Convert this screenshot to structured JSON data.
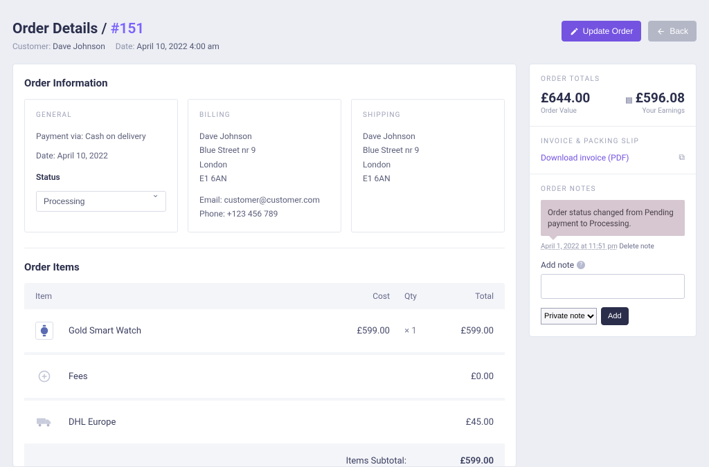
{
  "header": {
    "title_prefix": "Order Details",
    "slash": "/",
    "order_id": "#151",
    "customer_label": "Customer:",
    "customer_name": "Dave Johnson",
    "date_label": "Date:",
    "date_value": "April 10, 2022 4:00 am",
    "update_btn": "Update Order",
    "back_btn": "Back"
  },
  "info": {
    "section_title": "Order Information",
    "general": {
      "head": "GENERAL",
      "payment_line": "Payment via: Cash on delivery",
      "date_line": "Date: April 10, 2022",
      "status_label": "Status",
      "status_value": "Processing"
    },
    "billing": {
      "head": "BILLING",
      "name": "Dave Johnson",
      "street": "Blue Street nr 9",
      "city": "London",
      "postcode": "E1 6AN",
      "email_line": "Email: customer@customer.com",
      "phone_line": "Phone: +123 456 789"
    },
    "shipping": {
      "head": "SHIPPING",
      "name": "Dave Johnson",
      "street": "Blue Street nr 9",
      "city": "London",
      "postcode": "E1 6AN"
    }
  },
  "items_section": {
    "title": "Order Items",
    "col_item": "Item",
    "col_cost": "Cost",
    "col_qty": "Qty",
    "col_total": "Total",
    "rows": [
      {
        "icon": "watch",
        "name": "Gold Smart Watch",
        "cost": "£599.00",
        "qty": "× 1",
        "total": "£599.00"
      },
      {
        "icon": "plus",
        "name": "Fees",
        "cost": "",
        "qty": "",
        "total": "£0.00"
      },
      {
        "icon": "truck",
        "name": "DHL Europe",
        "cost": "",
        "qty": "",
        "total": "£45.00"
      }
    ],
    "subtotal_label": "Items Subtotal:",
    "subtotal_value": "£599.00"
  },
  "sidebar": {
    "totals": {
      "head": "ORDER TOTALS",
      "order_value": "£644.00",
      "order_value_label": "Order Value",
      "earnings": "£596.08",
      "earnings_label": "Your Earnings"
    },
    "invoice": {
      "head": "INVOICE & PACKING SLIP",
      "download": "Download invoice (PDF)"
    },
    "notes": {
      "head": "ORDER NOTES",
      "note_text": "Order status changed from Pending payment to Processing.",
      "timestamp": "April 1, 2022 at 11:51 pm",
      "delete": "Delete note",
      "add_label": "Add note",
      "select_value": "Private note",
      "add_btn": "Add"
    }
  }
}
